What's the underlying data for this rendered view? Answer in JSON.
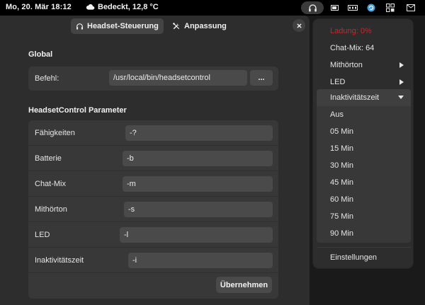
{
  "topbar": {
    "clock": "Mo, 20. Mär  18:12",
    "weather": "Bedeckt, 12,8 °C",
    "icons": [
      "headset-icon",
      "battery-icon",
      "network-icon",
      "update-icon",
      "apps-icon",
      "notifications-icon"
    ]
  },
  "window": {
    "tabs": [
      {
        "label": "Headset-Steuerung",
        "icon": "headset-icon",
        "active": true
      },
      {
        "label": "Anpassung",
        "icon": "tools-icon",
        "active": false
      }
    ],
    "global": {
      "title": "Global",
      "command_label": "Befehl:",
      "command_value": "/usr/local/bin/headsetcontrol",
      "browse_label": "..."
    },
    "params": {
      "title": "HeadsetControl Parameter",
      "rows": [
        {
          "label": "Fähigkeiten",
          "value": "-?"
        },
        {
          "label": "Batterie",
          "value": "-b"
        },
        {
          "label": "Chat-Mix",
          "value": "-m"
        },
        {
          "label": "Mithörton",
          "value": "-s"
        },
        {
          "label": "LED",
          "value": "-l"
        },
        {
          "label": "Inaktivitätszeit",
          "value": "-i"
        }
      ]
    },
    "apply_label": "Übernehmen"
  },
  "menu": {
    "items": [
      {
        "label": "Ladung: 0%",
        "style": "red"
      },
      {
        "label": "Chat-Mix: 64"
      },
      {
        "label": "Mithörton",
        "submenu": true
      },
      {
        "label": "LED",
        "submenu": true
      },
      {
        "label": "Inaktivitätszeit",
        "submenu": true,
        "open": true
      }
    ],
    "submenu_items": [
      "Aus",
      "05 Min",
      "15 Min",
      "30 Min",
      "45 Min",
      "60 Min",
      "75 Min",
      "90 Min"
    ],
    "settings_label": "Einstellungen"
  },
  "colors": {
    "warning": "#e01b24",
    "panel": "#000000",
    "window": "#2d2d2d",
    "card": "#383838"
  }
}
